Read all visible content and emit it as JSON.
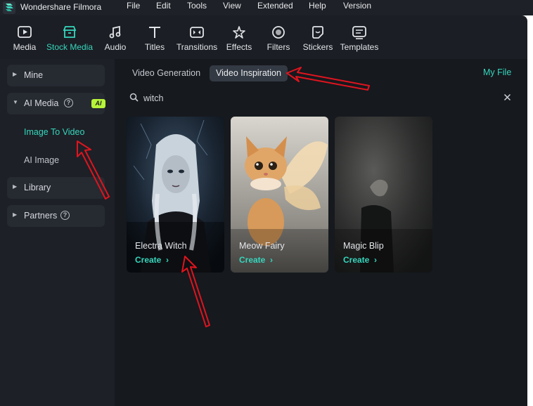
{
  "app": {
    "title": "Wondershare Filmora"
  },
  "menu": [
    "File",
    "Edit",
    "Tools",
    "View",
    "Extended",
    "Help",
    "Version"
  ],
  "toolbar": {
    "items": [
      {
        "label": "Media",
        "icon": "media-icon"
      },
      {
        "label": "Stock Media",
        "icon": "stock-media-icon",
        "active": true
      },
      {
        "label": "Audio",
        "icon": "audio-icon"
      },
      {
        "label": "Titles",
        "icon": "titles-icon"
      },
      {
        "label": "Transitions",
        "icon": "transitions-icon"
      },
      {
        "label": "Effects",
        "icon": "effects-icon"
      },
      {
        "label": "Filters",
        "icon": "filters-icon"
      },
      {
        "label": "Stickers",
        "icon": "stickers-icon"
      },
      {
        "label": "Templates",
        "icon": "templates-icon"
      }
    ]
  },
  "sidebar": {
    "mine": "Mine",
    "ai_media": "AI Media",
    "ai_badge": "AI",
    "image_to_video": "Image To Video",
    "ai_image": "AI Image",
    "library": "Library",
    "partners": "Partners"
  },
  "tabs": {
    "video_generation": "Video Generation",
    "video_inspiration": "Video Inspiration",
    "active": "Video Inspiration"
  },
  "my_file": "My File",
  "search": {
    "value": "witch"
  },
  "cards": [
    {
      "title": "Electra Witch",
      "action": "Create"
    },
    {
      "title": "Meow Fairy",
      "action": "Create"
    },
    {
      "title": "Magic Blip",
      "action": "Create"
    }
  ],
  "colors": {
    "accent": "#36d6bd",
    "annotation": "#e0141e",
    "ai_badge": "#b6f43a",
    "background": "#16191e"
  }
}
